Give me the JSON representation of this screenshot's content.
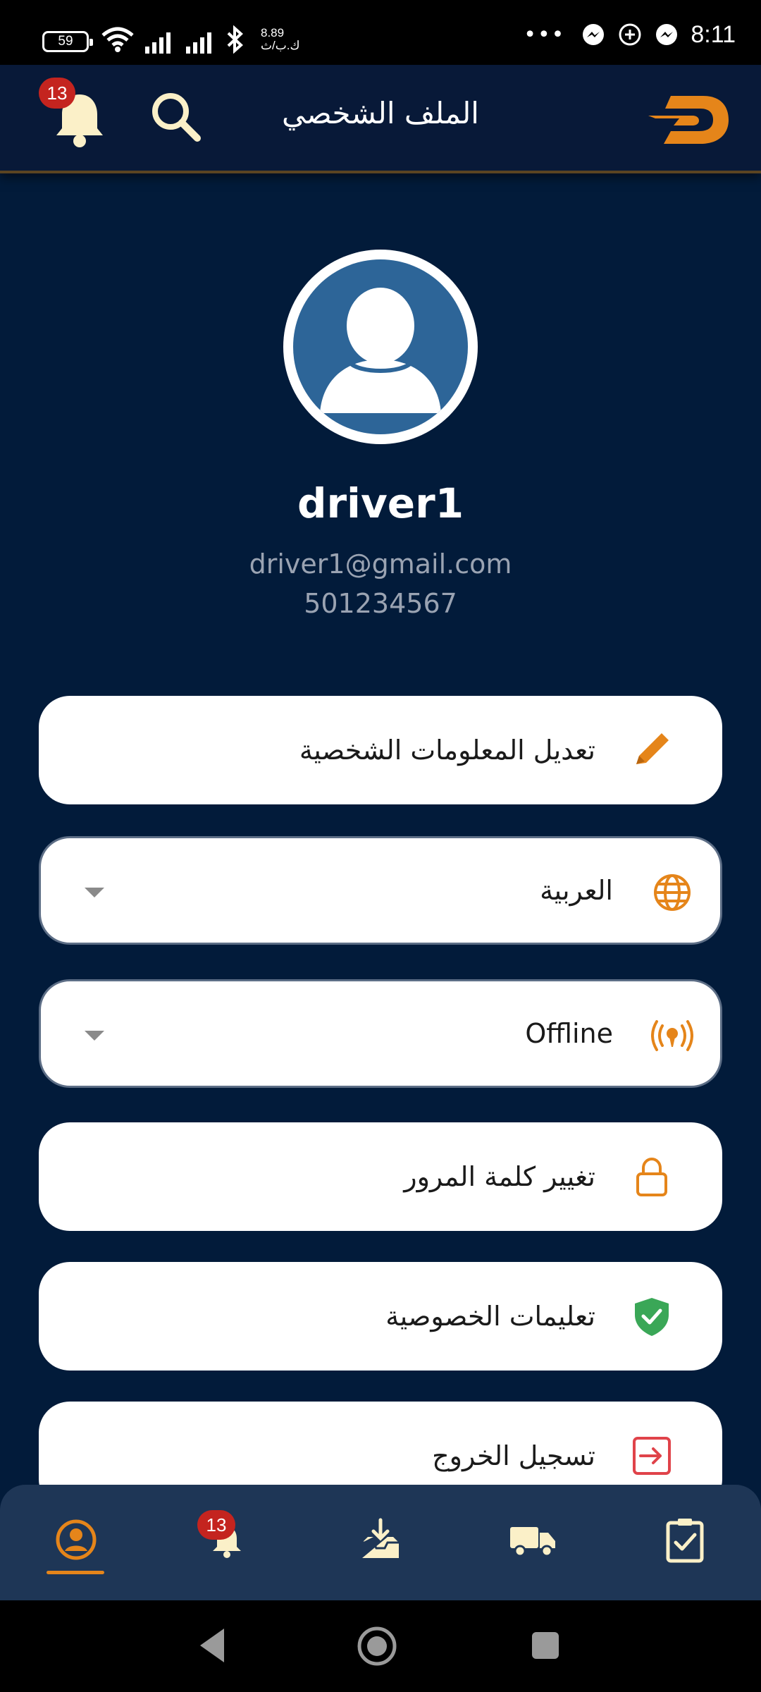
{
  "status_bar": {
    "battery": "59",
    "speed_value": "8.89",
    "speed_unit": "ك.ب/ث",
    "overflow": "•••",
    "time": "8:11"
  },
  "header": {
    "title": "الملف الشخصي",
    "notification_count": "13",
    "icons": [
      "bell-icon",
      "search-icon",
      "app-logo"
    ]
  },
  "profile": {
    "name": "driver1",
    "email": "driver1@gmail.com",
    "phone": "501234567"
  },
  "menu": {
    "edit_profile": "تعديل المعلومات الشخصية",
    "language_value": "العربية",
    "status_value": "Offline",
    "change_password": "تغيير كلمة المرور",
    "privacy": "تعليمات الخصوصية",
    "logout": "تسجيل الخروج"
  },
  "bottom_nav": {
    "items": [
      "profile-icon",
      "notifications-icon",
      "inbox-download-icon",
      "truck-icon",
      "clipboard-check-icon"
    ],
    "notification_count": "13",
    "active": "profile"
  },
  "colors": {
    "background": "#021b3a",
    "header": "#081938",
    "accent": "#e5851a",
    "badge": "#c4241f",
    "nav": "#1e3656",
    "success": "#3aa757",
    "danger": "#e0434a"
  }
}
